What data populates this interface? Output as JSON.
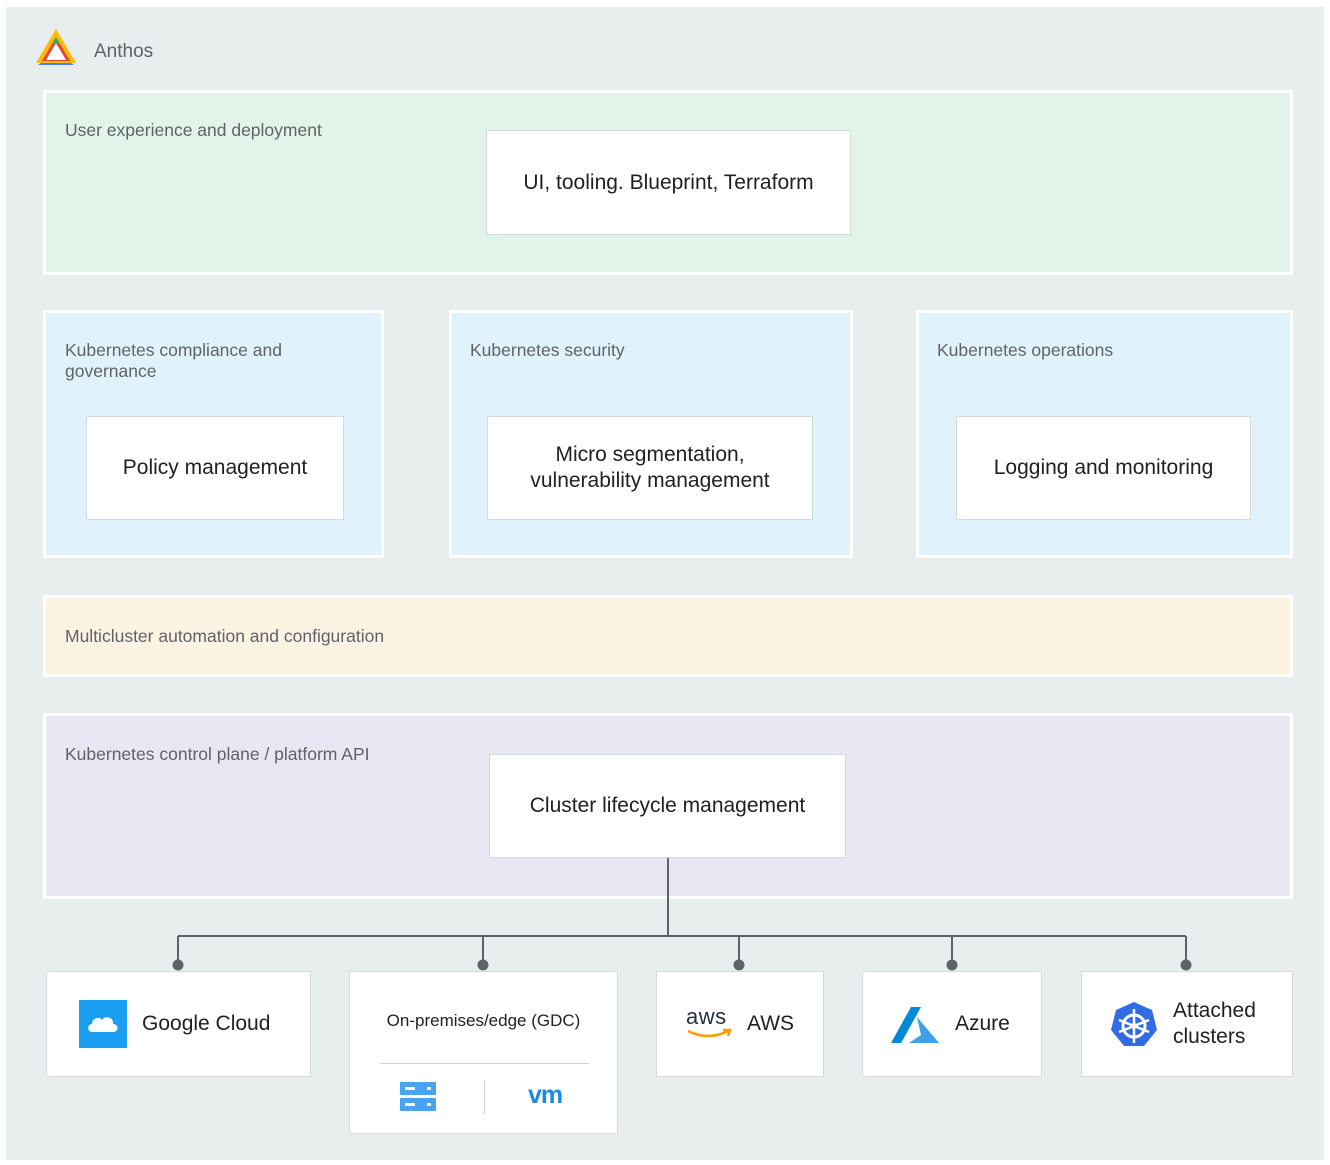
{
  "brand": {
    "name": "Anthos",
    "icon": "anthos-logo-icon"
  },
  "bands": {
    "ux": {
      "label": "User experience and deployment",
      "color": "#e2f3e9",
      "card": "UI, tooling. Blueprint, Terraform"
    },
    "compliance": {
      "label": "Kubernetes compliance and governance",
      "color": "#e0f3fc",
      "card": "Policy management"
    },
    "security": {
      "label": "Kubernetes security",
      "color": "#e0f3fc",
      "card": "Micro segmentation, vulnerability management"
    },
    "operations": {
      "label": "Kubernetes operations",
      "color": "#e0f3fc",
      "card": "Logging and monitoring"
    },
    "multicluster": {
      "label": "Multicluster automation and configuration",
      "color": "#fdf3e3"
    },
    "control_plane": {
      "label": "Kubernetes control plane / platform API",
      "color": "#e8e8f4",
      "card": "Cluster lifecycle management"
    }
  },
  "targets": {
    "google_cloud": {
      "label": "Google Cloud",
      "icon": "google-cloud-icon"
    },
    "on_prem": {
      "label": "On-premises/edge (GDC)",
      "icons": [
        "server-icon",
        "vmware-icon"
      ],
      "vm_text": "vm"
    },
    "aws": {
      "label": "AWS",
      "logo_text": "aws",
      "icon": "aws-logo-icon"
    },
    "azure": {
      "label": "Azure",
      "icon": "azure-logo-icon"
    },
    "attached": {
      "label": "Attached clusters",
      "icon": "kubernetes-icon"
    }
  },
  "colors": {
    "line": "#5f6368",
    "background": "#e8eeee",
    "google_blue": "#1a9ff0",
    "aws_orange": "#ff9900",
    "kubernetes_blue": "#326ce5"
  }
}
